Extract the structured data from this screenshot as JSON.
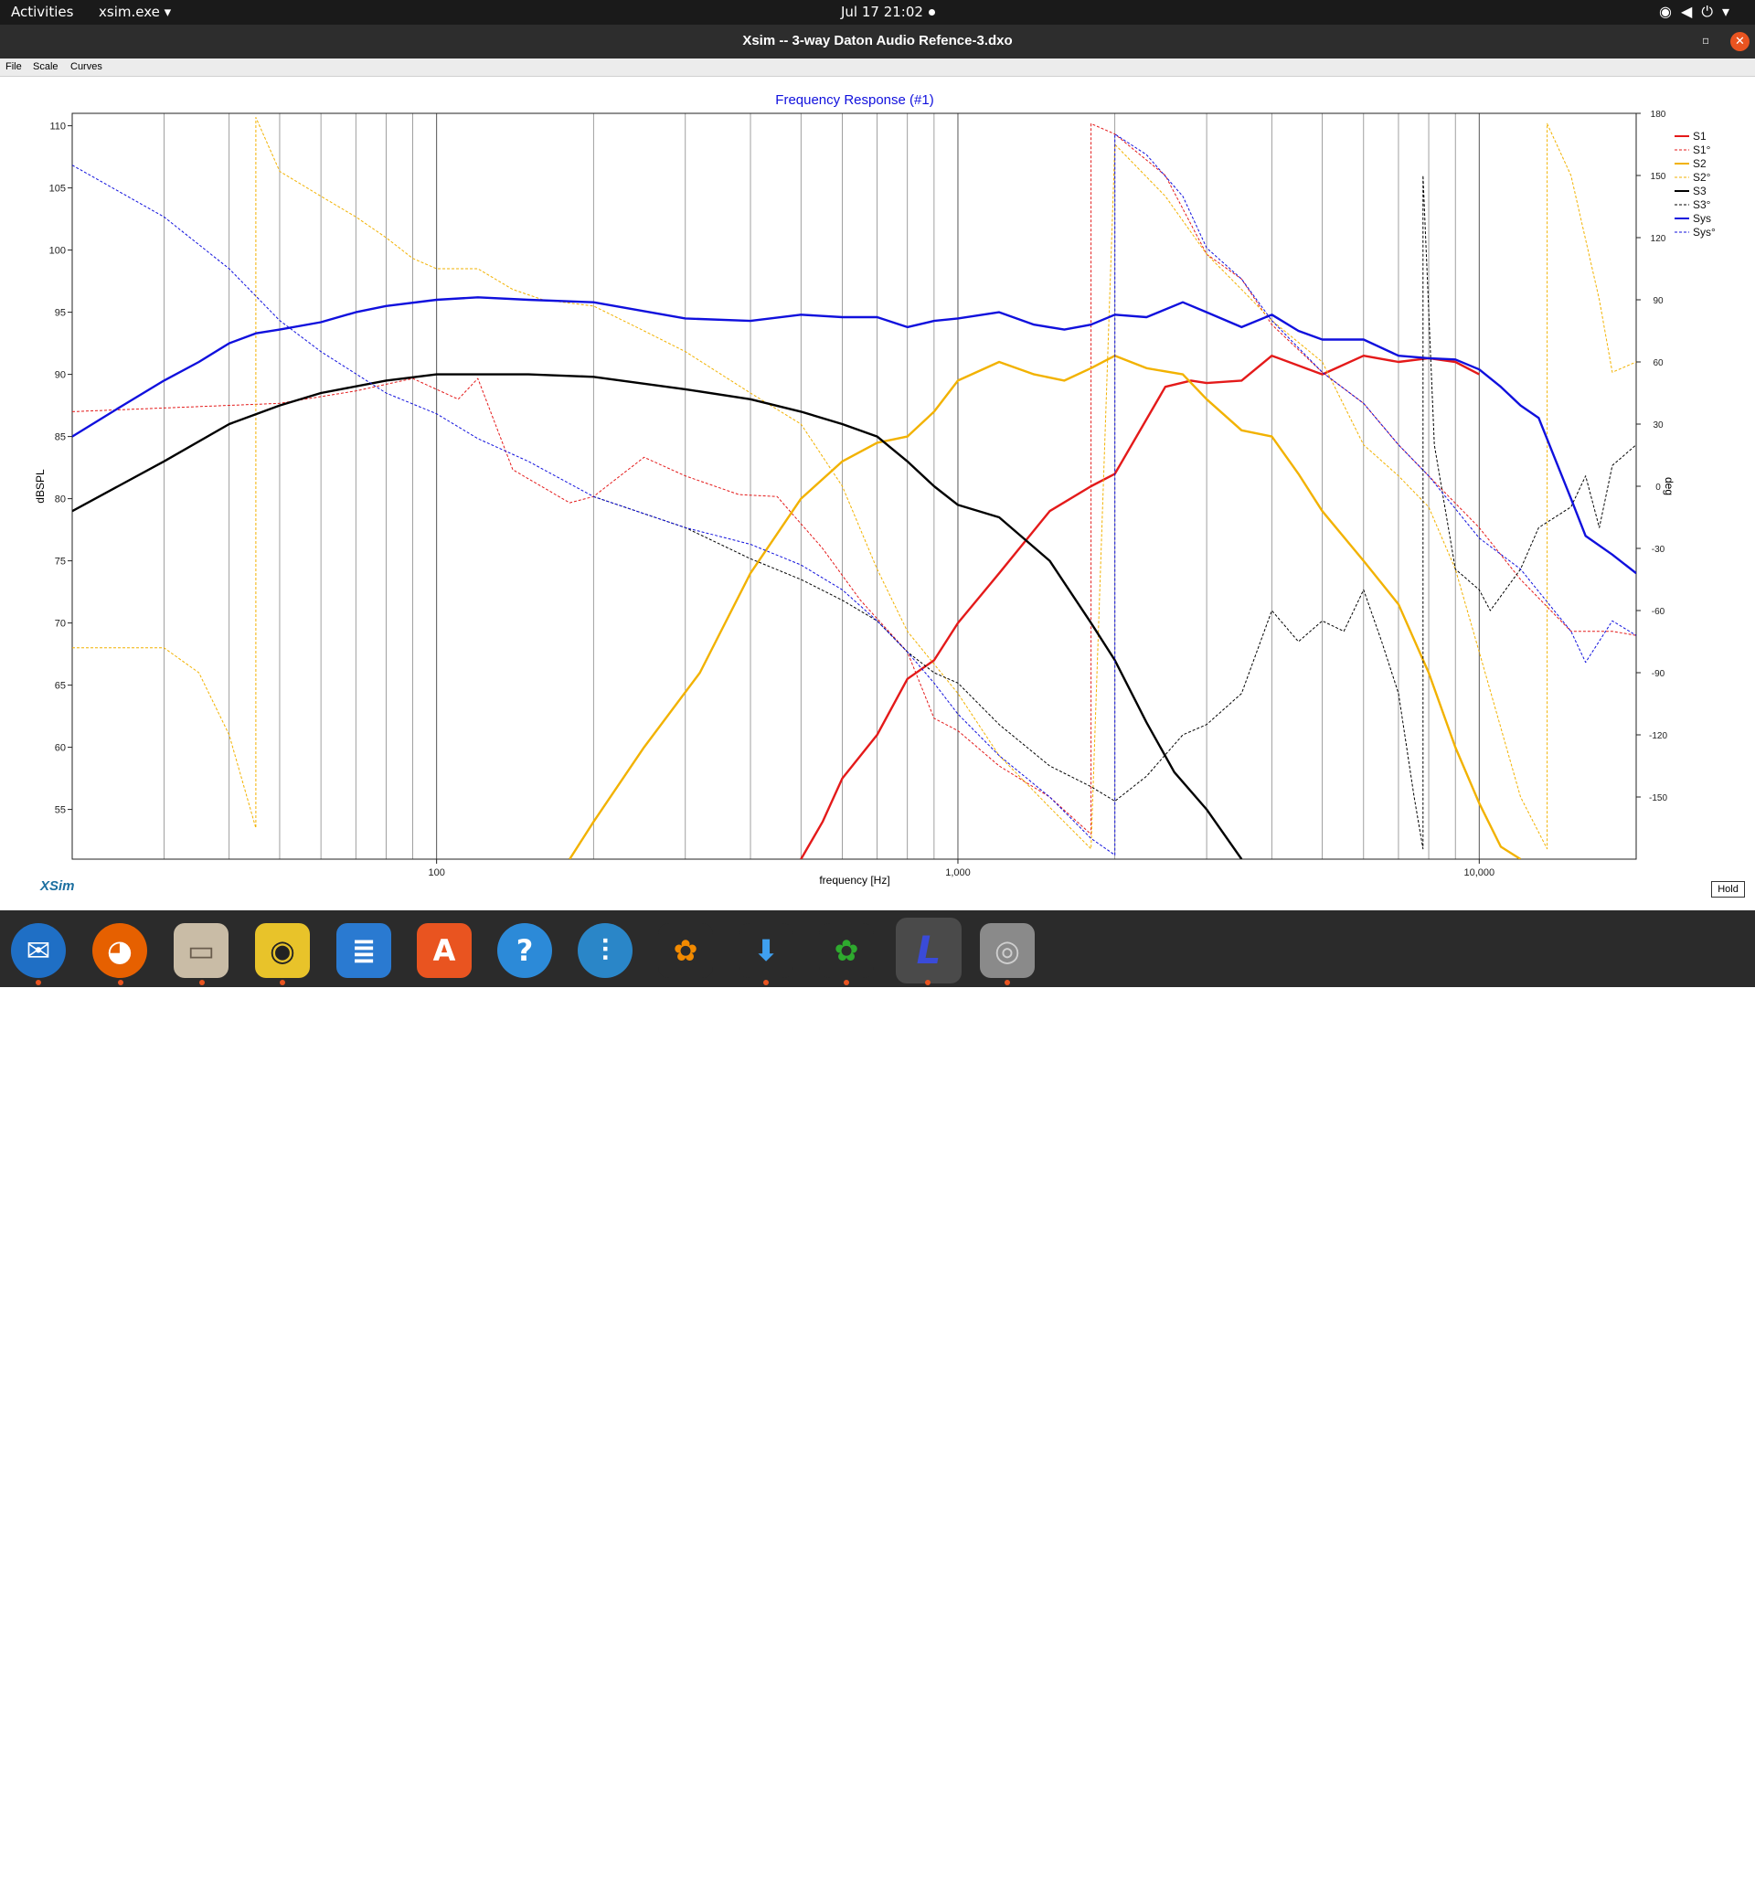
{
  "topbar": {
    "activities": "Activities",
    "app_menu": "xsim.exe ▾",
    "clock": "Jul 17  21:02"
  },
  "window": {
    "title": "Xsim -- 3-way Daton Audio Refence-3.dxo"
  },
  "menubar": {
    "items": [
      "File",
      "Scale",
      "Curves"
    ]
  },
  "footer": {
    "logo": "XSim",
    "hold_button": "Hold"
  },
  "dock": {
    "icons": [
      "thunderbird-icon",
      "firefox-icon",
      "files-icon",
      "rhythmbox-icon",
      "libreoffice-writer-icon",
      "app-center-icon",
      "help-icon",
      "mixer-icon",
      "playonlinux-icon",
      "download-icon",
      "playonlinux-2-icon",
      "xsim-icon",
      "disk-icon"
    ]
  },
  "chart_data": {
    "type": "line",
    "title": "Frequency Response (#1)",
    "xlabel": "frequency [Hz]",
    "ylabel": "dBSPL",
    "y2label": "deg",
    "xscale": "log",
    "xlim": [
      20,
      20000
    ],
    "ylim": [
      51,
      111
    ],
    "y2lim": [
      -180,
      180
    ],
    "x_ticks": [
      100,
      1000,
      10000
    ],
    "x_tick_labels": [
      "100",
      "1,000",
      "10,000"
    ],
    "y_ticks": [
      55,
      60,
      65,
      70,
      75,
      80,
      85,
      90,
      95,
      100,
      105,
      110
    ],
    "y_tick_labels": [
      "55",
      "60",
      "65",
      "70",
      "75",
      "80",
      "85",
      "90",
      "95",
      "100",
      "105",
      "110"
    ],
    "y2_ticks": [
      -150,
      -120,
      -90,
      -60,
      -30,
      0,
      30,
      60,
      90,
      120,
      150,
      180
    ],
    "y2_tick_labels": [
      "-150",
      "-120",
      "-90",
      "-60",
      "-30",
      "0",
      "30",
      "60",
      "90",
      "120",
      "150",
      "180"
    ],
    "grid": "vertical log lines",
    "legend_placement": "right",
    "series": [
      {
        "name": "S1",
        "axis": "left",
        "color": "#e41a1a",
        "dashed": false,
        "points": [
          [
            500,
            51
          ],
          [
            550,
            54
          ],
          [
            600,
            57.5
          ],
          [
            700,
            61
          ],
          [
            800,
            65.5
          ],
          [
            900,
            67
          ],
          [
            1000,
            70
          ],
          [
            1200,
            74
          ],
          [
            1500,
            79
          ],
          [
            1800,
            81
          ],
          [
            2000,
            82
          ],
          [
            2500,
            89
          ],
          [
            2800,
            89.5
          ],
          [
            3000,
            89.3
          ],
          [
            3500,
            89.5
          ],
          [
            4000,
            91.5
          ],
          [
            5000,
            90
          ],
          [
            6000,
            91.5
          ],
          [
            7000,
            91
          ],
          [
            8000,
            91.3
          ],
          [
            9000,
            91
          ],
          [
            10000,
            90
          ]
        ]
      },
      {
        "name": "S1°",
        "axis": "right",
        "color": "#e41a1a",
        "dashed": true,
        "points": [
          [
            20,
            36
          ],
          [
            50,
            40
          ],
          [
            70,
            46
          ],
          [
            90,
            52
          ],
          [
            110,
            42
          ],
          [
            120,
            52
          ],
          [
            140,
            8
          ],
          [
            180,
            -8
          ],
          [
            200,
            -5
          ],
          [
            250,
            14
          ],
          [
            300,
            5
          ],
          [
            380,
            -4
          ],
          [
            450,
            -5
          ],
          [
            550,
            -30
          ],
          [
            650,
            -55
          ],
          [
            800,
            -80
          ],
          [
            900,
            -112
          ],
          [
            1000,
            -118
          ],
          [
            1200,
            -135
          ],
          [
            1500,
            -150
          ],
          [
            1800,
            -168
          ],
          [
            1800,
            175
          ],
          [
            2000,
            170
          ],
          [
            2500,
            150
          ],
          [
            3000,
            112
          ],
          [
            3500,
            100
          ],
          [
            4000,
            78
          ],
          [
            5000,
            55
          ],
          [
            6000,
            40
          ],
          [
            7000,
            20
          ],
          [
            8000,
            5
          ],
          [
            10000,
            -20
          ],
          [
            12000,
            -45
          ],
          [
            15000,
            -70
          ],
          [
            18000,
            -70
          ],
          [
            20000,
            -72
          ]
        ]
      },
      {
        "name": "S2",
        "axis": "left",
        "color": "#f2b200",
        "dashed": false,
        "points": [
          [
            180,
            51
          ],
          [
            200,
            54
          ],
          [
            250,
            60
          ],
          [
            320,
            66
          ],
          [
            400,
            74
          ],
          [
            500,
            80
          ],
          [
            600,
            83
          ],
          [
            700,
            84.5
          ],
          [
            800,
            85
          ],
          [
            900,
            87
          ],
          [
            1000,
            89.5
          ],
          [
            1200,
            91
          ],
          [
            1400,
            90
          ],
          [
            1600,
            89.5
          ],
          [
            1800,
            90.5
          ],
          [
            2000,
            91.5
          ],
          [
            2300,
            90.5
          ],
          [
            2700,
            90
          ],
          [
            3000,
            88
          ],
          [
            3500,
            85.5
          ],
          [
            4000,
            85
          ],
          [
            4500,
            82
          ],
          [
            5000,
            79
          ],
          [
            6000,
            75
          ],
          [
            7000,
            71.5
          ],
          [
            8000,
            66
          ],
          [
            9000,
            60
          ],
          [
            10000,
            55.5
          ],
          [
            11000,
            52
          ],
          [
            12000,
            51
          ]
        ]
      },
      {
        "name": "S2°",
        "axis": "right",
        "color": "#f2b200",
        "dashed": true,
        "points": [
          [
            20,
            -78
          ],
          [
            30,
            -78
          ],
          [
            35,
            -90
          ],
          [
            40,
            -120
          ],
          [
            45,
            -165
          ],
          [
            45,
            178
          ],
          [
            50,
            152
          ],
          [
            60,
            140
          ],
          [
            70,
            130
          ],
          [
            80,
            120
          ],
          [
            90,
            110
          ],
          [
            100,
            105
          ],
          [
            120,
            105
          ],
          [
            140,
            95
          ],
          [
            160,
            90
          ],
          [
            200,
            87
          ],
          [
            250,
            75
          ],
          [
            300,
            65
          ],
          [
            400,
            45
          ],
          [
            500,
            30
          ],
          [
            600,
            0
          ],
          [
            700,
            -40
          ],
          [
            800,
            -70
          ],
          [
            1000,
            -100
          ],
          [
            1200,
            -130
          ],
          [
            1500,
            -155
          ],
          [
            1800,
            -175
          ],
          [
            2000,
            165
          ],
          [
            2500,
            140
          ],
          [
            3000,
            112
          ],
          [
            3500,
            95
          ],
          [
            4000,
            80
          ],
          [
            5000,
            60
          ],
          [
            6000,
            20
          ],
          [
            7000,
            5
          ],
          [
            8000,
            -10
          ],
          [
            9000,
            -40
          ],
          [
            10000,
            -80
          ],
          [
            12000,
            -150
          ],
          [
            13500,
            -175
          ],
          [
            13500,
            175
          ],
          [
            15000,
            150
          ],
          [
            17000,
            90
          ],
          [
            18000,
            55
          ],
          [
            20000,
            60
          ]
        ]
      },
      {
        "name": "S3",
        "axis": "left",
        "color": "#000000",
        "dashed": false,
        "points": [
          [
            20,
            79
          ],
          [
            30,
            83
          ],
          [
            40,
            86
          ],
          [
            50,
            87.5
          ],
          [
            60,
            88.5
          ],
          [
            80,
            89.5
          ],
          [
            100,
            90
          ],
          [
            120,
            90
          ],
          [
            150,
            90
          ],
          [
            200,
            89.8
          ],
          [
            300,
            88.8
          ],
          [
            400,
            88
          ],
          [
            500,
            87
          ],
          [
            600,
            86
          ],
          [
            700,
            85
          ],
          [
            800,
            83
          ],
          [
            900,
            81
          ],
          [
            1000,
            79.5
          ],
          [
            1200,
            78.5
          ],
          [
            1500,
            75
          ],
          [
            1800,
            70
          ],
          [
            2000,
            67
          ],
          [
            2300,
            62
          ],
          [
            2600,
            58
          ],
          [
            3000,
            55
          ],
          [
            3500,
            51
          ]
        ]
      },
      {
        "name": "S3°",
        "axis": "right",
        "color": "#000000",
        "dashed": true,
        "points": [
          [
            200,
            -5
          ],
          [
            300,
            -20
          ],
          [
            400,
            -35
          ],
          [
            500,
            -45
          ],
          [
            600,
            -55
          ],
          [
            700,
            -65
          ],
          [
            800,
            -80
          ],
          [
            900,
            -90
          ],
          [
            1000,
            -95
          ],
          [
            1200,
            -115
          ],
          [
            1500,
            -135
          ],
          [
            1800,
            -145
          ],
          [
            2000,
            -152
          ],
          [
            2300,
            -140
          ],
          [
            2700,
            -120
          ],
          [
            3000,
            -115
          ],
          [
            3500,
            -100
          ],
          [
            4000,
            -60
          ],
          [
            4500,
            -75
          ],
          [
            5000,
            -65
          ],
          [
            5500,
            -70
          ],
          [
            6000,
            -50
          ],
          [
            6500,
            -75
          ],
          [
            7000,
            -100
          ],
          [
            7500,
            -150
          ],
          [
            7800,
            -175
          ],
          [
            7800,
            150
          ],
          [
            8200,
            20
          ],
          [
            9000,
            -40
          ],
          [
            10000,
            -50
          ],
          [
            10500,
            -60
          ],
          [
            12000,
            -40
          ],
          [
            13000,
            -20
          ],
          [
            15000,
            -10
          ],
          [
            16000,
            5
          ],
          [
            17000,
            -20
          ],
          [
            18000,
            10
          ],
          [
            20000,
            20
          ]
        ]
      },
      {
        "name": "Sys",
        "axis": "left",
        "color": "#1010dd",
        "dashed": false,
        "points": [
          [
            20,
            85
          ],
          [
            25,
            87.5
          ],
          [
            30,
            89.5
          ],
          [
            35,
            91
          ],
          [
            40,
            92.5
          ],
          [
            45,
            93.3
          ],
          [
            50,
            93.6
          ],
          [
            60,
            94.2
          ],
          [
            70,
            95
          ],
          [
            80,
            95.5
          ],
          [
            100,
            96
          ],
          [
            120,
            96.2
          ],
          [
            150,
            96
          ],
          [
            200,
            95.8
          ],
          [
            300,
            94.5
          ],
          [
            400,
            94.3
          ],
          [
            500,
            94.8
          ],
          [
            600,
            94.6
          ],
          [
            700,
            94.6
          ],
          [
            800,
            93.8
          ],
          [
            900,
            94.3
          ],
          [
            1000,
            94.5
          ],
          [
            1200,
            95
          ],
          [
            1400,
            94
          ],
          [
            1600,
            93.6
          ],
          [
            1800,
            94
          ],
          [
            2000,
            94.8
          ],
          [
            2300,
            94.6
          ],
          [
            2700,
            95.8
          ],
          [
            3000,
            95
          ],
          [
            3500,
            93.8
          ],
          [
            4000,
            94.8
          ],
          [
            4500,
            93.5
          ],
          [
            5000,
            92.8
          ],
          [
            6000,
            92.8
          ],
          [
            7000,
            91.5
          ],
          [
            8000,
            91.3
          ],
          [
            9000,
            91.2
          ],
          [
            10000,
            90.4
          ],
          [
            11000,
            89
          ],
          [
            12000,
            87.5
          ],
          [
            13000,
            86.5
          ],
          [
            15000,
            80
          ],
          [
            16000,
            77
          ],
          [
            18000,
            75.5
          ],
          [
            20000,
            74
          ]
        ]
      },
      {
        "name": "Sys°",
        "axis": "right",
        "color": "#1010dd",
        "dashed": true,
        "points": [
          [
            20,
            155
          ],
          [
            30,
            130
          ],
          [
            40,
            105
          ],
          [
            50,
            80
          ],
          [
            60,
            65
          ],
          [
            80,
            45
          ],
          [
            100,
            35
          ],
          [
            120,
            23
          ],
          [
            150,
            12
          ],
          [
            200,
            -5
          ],
          [
            300,
            -20
          ],
          [
            400,
            -28
          ],
          [
            500,
            -38
          ],
          [
            600,
            -50
          ],
          [
            700,
            -65
          ],
          [
            800,
            -80
          ],
          [
            900,
            -95
          ],
          [
            1000,
            -110
          ],
          [
            1200,
            -130
          ],
          [
            1500,
            -150
          ],
          [
            1800,
            -170
          ],
          [
            2000,
            -178
          ],
          [
            2000,
            170
          ],
          [
            2300,
            160
          ],
          [
            2700,
            140
          ],
          [
            3000,
            115
          ],
          [
            3500,
            100
          ],
          [
            4000,
            80
          ],
          [
            5000,
            55
          ],
          [
            6000,
            40
          ],
          [
            7000,
            20
          ],
          [
            8000,
            5
          ],
          [
            10000,
            -25
          ],
          [
            12000,
            -40
          ],
          [
            15000,
            -70
          ],
          [
            16000,
            -85
          ],
          [
            18000,
            -65
          ],
          [
            20000,
            -72
          ]
        ]
      }
    ]
  }
}
